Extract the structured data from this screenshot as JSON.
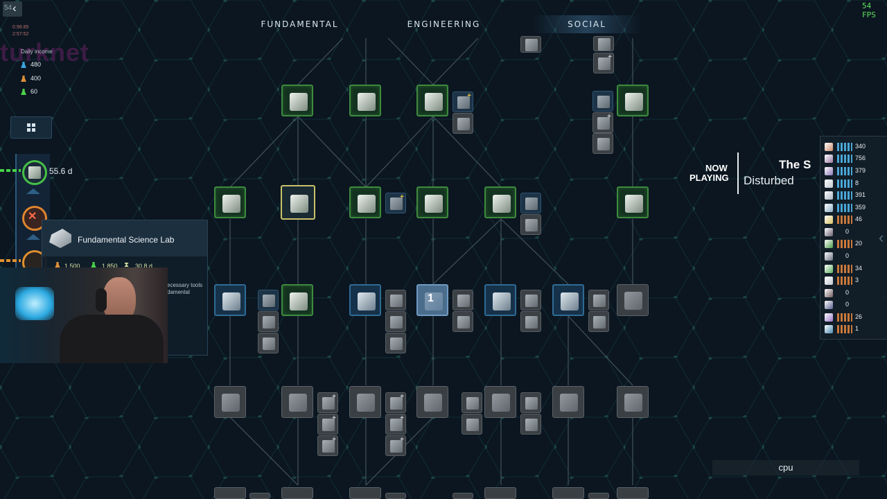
{
  "overlay": {
    "fps": "54 FPS",
    "back_badge": "54",
    "debug_line1": "0.99.85",
    "debug_line2": "2:57:52",
    "brand": "turknet",
    "daily_label": "Daily income"
  },
  "tabs": [
    {
      "label": "FUNDAMENTAL",
      "active": false
    },
    {
      "label": "ENGINEERING",
      "active": false
    },
    {
      "label": "SOCIAL",
      "active": true
    }
  ],
  "daily_income": [
    {
      "value": "480",
      "color": "#3aa7e0"
    },
    {
      "value": "400",
      "color": "#e0903a"
    },
    {
      "value": "60",
      "color": "#4bd04b"
    }
  ],
  "sidebar": {
    "progress_value": "55.6 d"
  },
  "tooltip": {
    "title": "Fundamental Science Lab",
    "cost1": "1,500",
    "cost2": "1,850",
    "time": "30.8 d",
    "desc_line1": "ecessary tools",
    "desc_line2": "damental"
  },
  "tech_node_badge": "1",
  "now_playing": {
    "label_line1": "NOW",
    "label_line2": "PLAYING",
    "title": "The S",
    "artist": "Disturbed"
  },
  "resources": [
    {
      "value": "340",
      "bar": "blue",
      "color": "#c98a6a"
    },
    {
      "value": "756",
      "bar": "blue",
      "color": "#9a7aa6"
    },
    {
      "value": "379",
      "bar": "blue",
      "color": "#8a78b8"
    },
    {
      "value": "8",
      "bar": "blue",
      "color": "#c0c8d0"
    },
    {
      "value": "391",
      "bar": "blue",
      "color": "#a8b4c0"
    },
    {
      "value": "359",
      "bar": "blue",
      "color": "#8fb0c8"
    },
    {
      "value": "46",
      "bar": "orange",
      "color": "#d8c060"
    },
    {
      "value": "0",
      "bar": "none",
      "color": "#6a6070"
    },
    {
      "value": "20",
      "bar": "orange",
      "color": "#4a9a4a"
    },
    {
      "value": "0",
      "bar": "none",
      "color": "#6a7080"
    },
    {
      "value": "34",
      "bar": "orange",
      "color": "#60b060"
    },
    {
      "value": "3",
      "bar": "orange",
      "color": "#c0c8d0"
    },
    {
      "value": "0",
      "bar": "none",
      "color": "#705a60"
    },
    {
      "value": "0",
      "bar": "none",
      "color": "#5a6090"
    },
    {
      "value": "26",
      "bar": "orange",
      "color": "#9a78c8"
    },
    {
      "value": "1",
      "bar": "orange",
      "color": "#4a8ab0"
    }
  ],
  "cpu_label": "cpu"
}
